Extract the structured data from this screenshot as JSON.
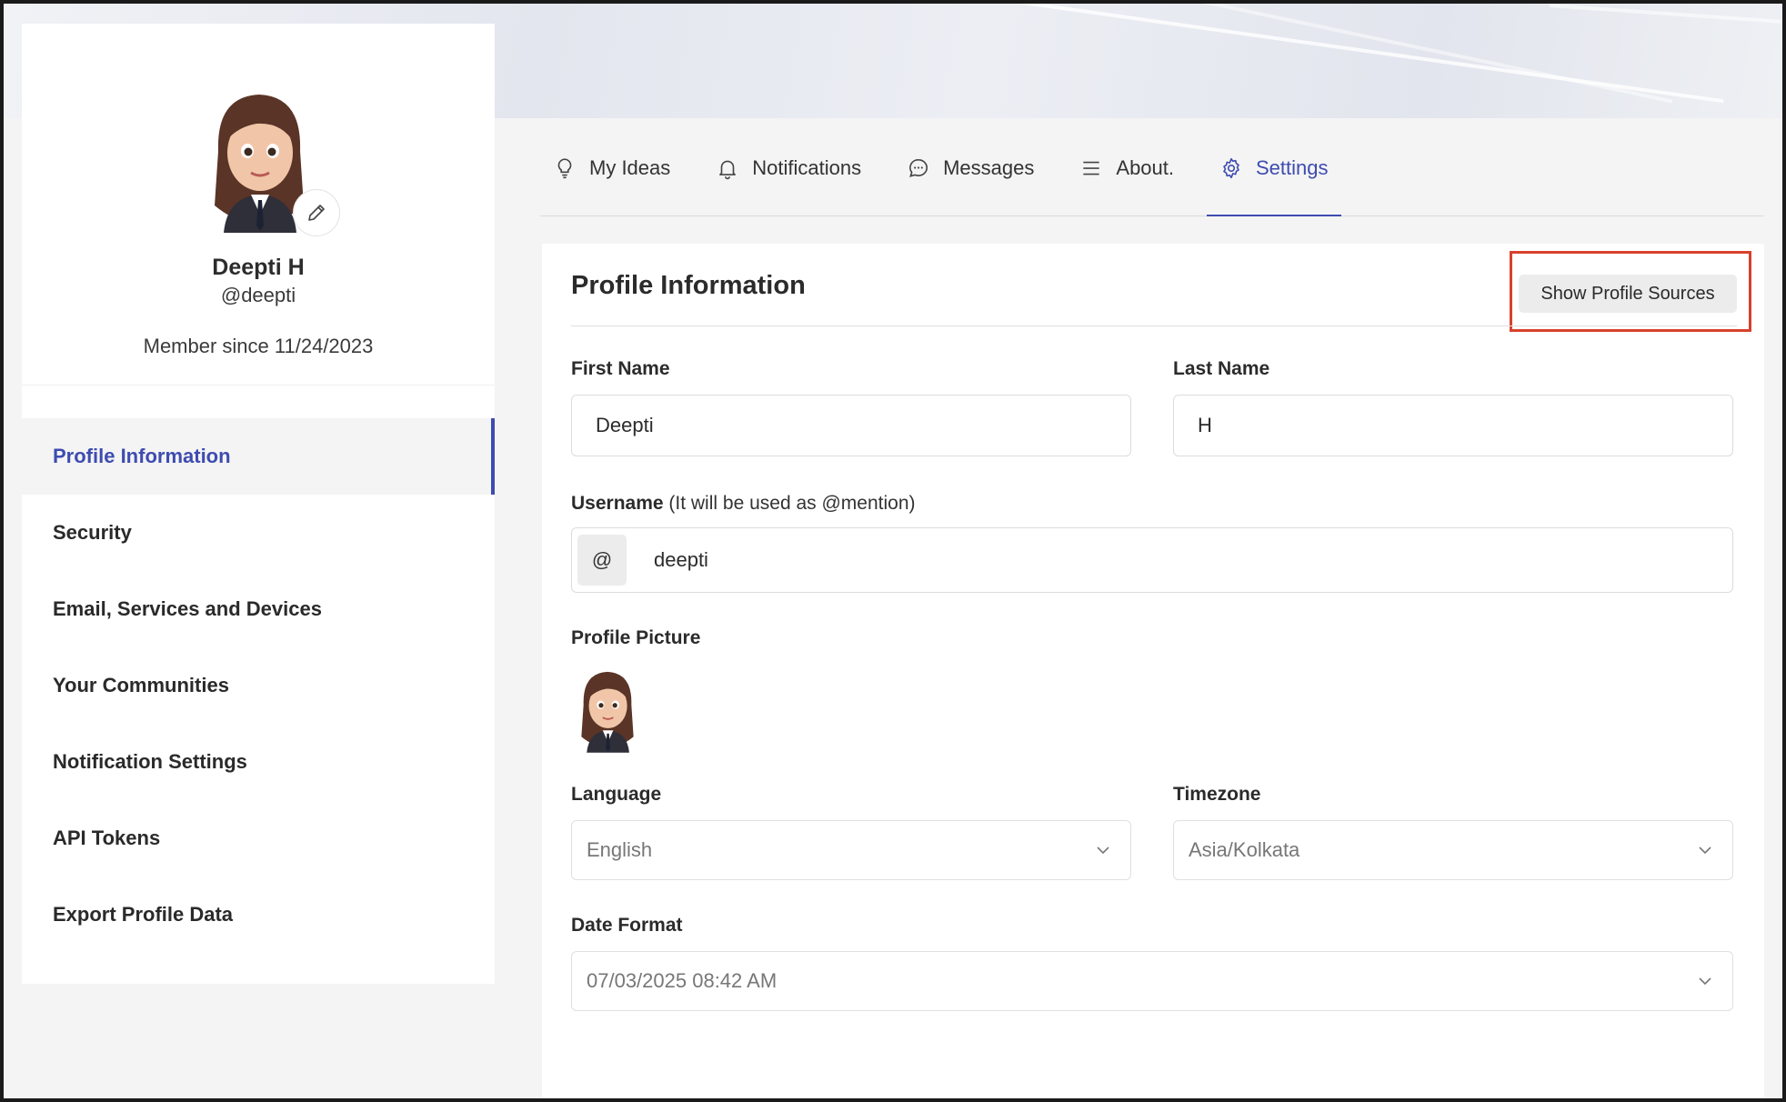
{
  "profile": {
    "name": "Deepti H",
    "handle": "@deepti",
    "member_since": "Member since 11/24/2023"
  },
  "sidebar": {
    "items": [
      {
        "label": "Profile Information",
        "active": true
      },
      {
        "label": "Security"
      },
      {
        "label": "Email, Services and Devices"
      },
      {
        "label": "Your Communities"
      },
      {
        "label": "Notification Settings"
      },
      {
        "label": "API Tokens"
      },
      {
        "label": "Export Profile Data"
      }
    ]
  },
  "tabs": [
    {
      "label": "My Ideas",
      "icon": "lightbulb-icon"
    },
    {
      "label": "Notifications",
      "icon": "bell-icon"
    },
    {
      "label": "Messages",
      "icon": "chat-bubble-icon"
    },
    {
      "label": "About.",
      "icon": "menu-lines-icon"
    },
    {
      "label": "Settings",
      "icon": "gear-icon",
      "active": true
    }
  ],
  "form": {
    "title": "Profile Information",
    "show_sources_label": "Show Profile Sources",
    "first_name_label": "First Name",
    "first_name_value": "Deepti",
    "last_name_label": "Last Name",
    "last_name_value": "H",
    "username_label": "Username",
    "username_hint": " (It will be used as @mention)",
    "username_prefix": "@",
    "username_value": "deepti",
    "picture_label": "Profile Picture",
    "language_label": "Language",
    "language_value": "English",
    "timezone_label": "Timezone",
    "timezone_value": "Asia/Kolkata",
    "date_format_label": "Date Format",
    "date_format_value": "07/03/2025 08:42 AM"
  },
  "colors": {
    "accent": "#3e4cb0",
    "highlight": "#d8412c",
    "background": "#f4f4f4"
  }
}
